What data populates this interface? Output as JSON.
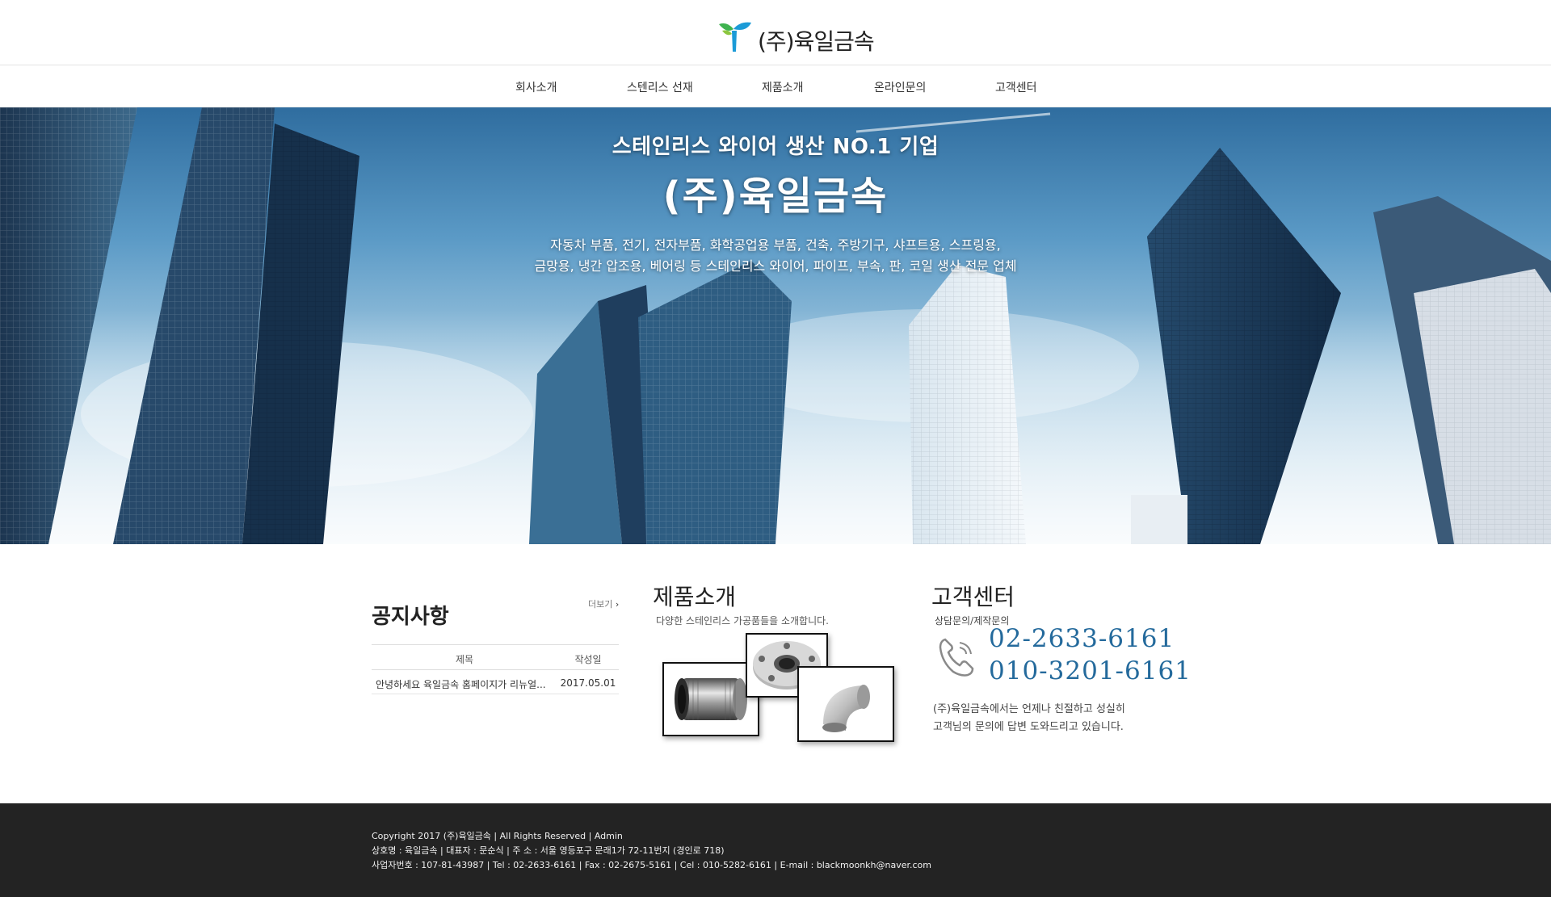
{
  "header": {
    "logo_text": "(주)육일금속"
  },
  "nav": {
    "items": [
      "회사소개",
      "스텐리스 선재",
      "제품소개",
      "온라인문의",
      "고객센터"
    ]
  },
  "hero": {
    "subtitle": "스테인리스 와이어 생산 NO.1 기업",
    "title": "(주)육일금속",
    "desc_line1": "자동차 부품, 전기, 전자부품, 화학공업용 부품, 건축, 주방기구, 샤프트용, 스프링용,",
    "desc_line2": "금망용, 냉간 압조용, 베어링 등 스테인리스 와이어, 파이프, 부속, 판, 코일 생산 전문 업체"
  },
  "notice": {
    "title": "공지사항",
    "more": "더보기",
    "col_title": "제목",
    "col_date": "작성일",
    "rows": [
      {
        "title": "안녕하세요 육일금속 홈페이지가 리뉴얼...",
        "date": "2017.05.01"
      }
    ]
  },
  "products": {
    "title": "제품소개",
    "desc": "다양한 스테인리스 가공품들을 소개합니다."
  },
  "customer": {
    "title": "고객센터",
    "sub": "상담문의/제작문의",
    "phone1": "02-2633-6161",
    "phone2": "010-3201-6161",
    "msg_line1": "(주)육일금속에서는 언제나 친절하고 성실히",
    "msg_line2": "고객님의 문의에 답변 도와드리고 있습니다."
  },
  "footer": {
    "line1": "Copyright 2017 (주)육일금속 | All Rights Reserved | Admin",
    "line2": "상호명 : 육일금속 | 대표자 : 문순식 | 주 소 : 서울 영등포구 문래1가 72-11번지 (경인로 718)",
    "line3": "사업자번호 : 107-81-43987 | Tel : 02-2633-6161 | Fax : 02-2675-5161 | Cel : 010-5282-6161 | E-mail : blackmoonkh@naver.com"
  },
  "colors": {
    "phone": "#246a9c",
    "footer_bg": "#232323",
    "logo_green": "#3fb34f",
    "logo_blue": "#1b9bd7"
  },
  "icons": [
    "logo-mark-icon",
    "chevron-right-icon",
    "phone-icon"
  ]
}
